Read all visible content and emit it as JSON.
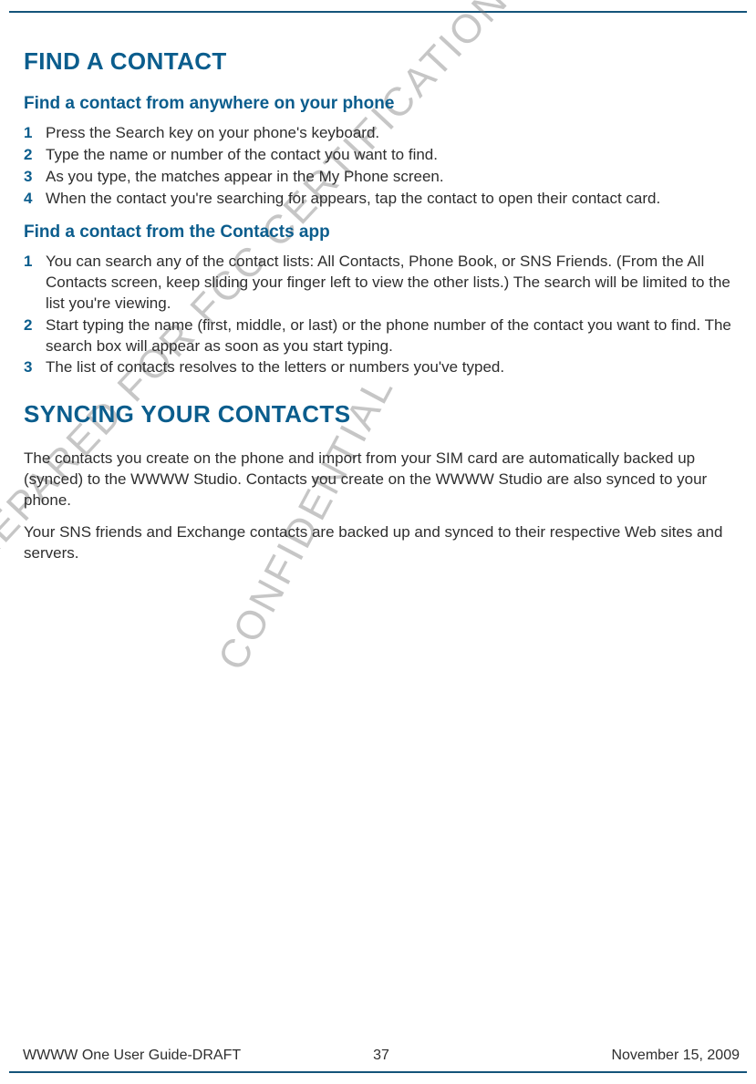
{
  "h1a": "FIND A CONTACT",
  "sub1": "Find a contact from anywhere on your phone",
  "steps1": [
    "Press the Search key on your phone's keyboard.",
    "Type the name or number of the contact you want to find.",
    "As you type, the matches appear in the My Phone screen.",
    "When the contact you're searching for appears, tap the contact to open their contact card."
  ],
  "sub2": "Find a contact from the Contacts app",
  "steps2": [
    "You can search any of the contact lists: All Contacts, Phone Book, or SNS Friends. (From the All Contacts screen, keep sliding your finger left to view the other lists.) The search will be limited to the list you're viewing.",
    "Start typing the name (first, middle, or last) or the phone number of the contact you want to find. The search box will appear as soon as you start typing.",
    "The list of contacts resolves to the letters or numbers you've typed."
  ],
  "h1b": "SYNCING YOUR CONTACTS",
  "para1": "The contacts you create on the phone and import from your SIM card are automatically backed up (synced) to the WWWW Studio. Contacts you create on the WWWW Studio are also synced to your phone.",
  "para2": "Your SNS friends and Exchange contacts are backed up and synced to their respective Web sites and servers.",
  "watermark1": "PREPARED FOR FCC CERTIFICATION",
  "watermark2": "CONFIDENTIAL",
  "footer": {
    "left": "WWWW One User Guide-DRAFT",
    "center": "37",
    "right": "November 15, 2009"
  }
}
